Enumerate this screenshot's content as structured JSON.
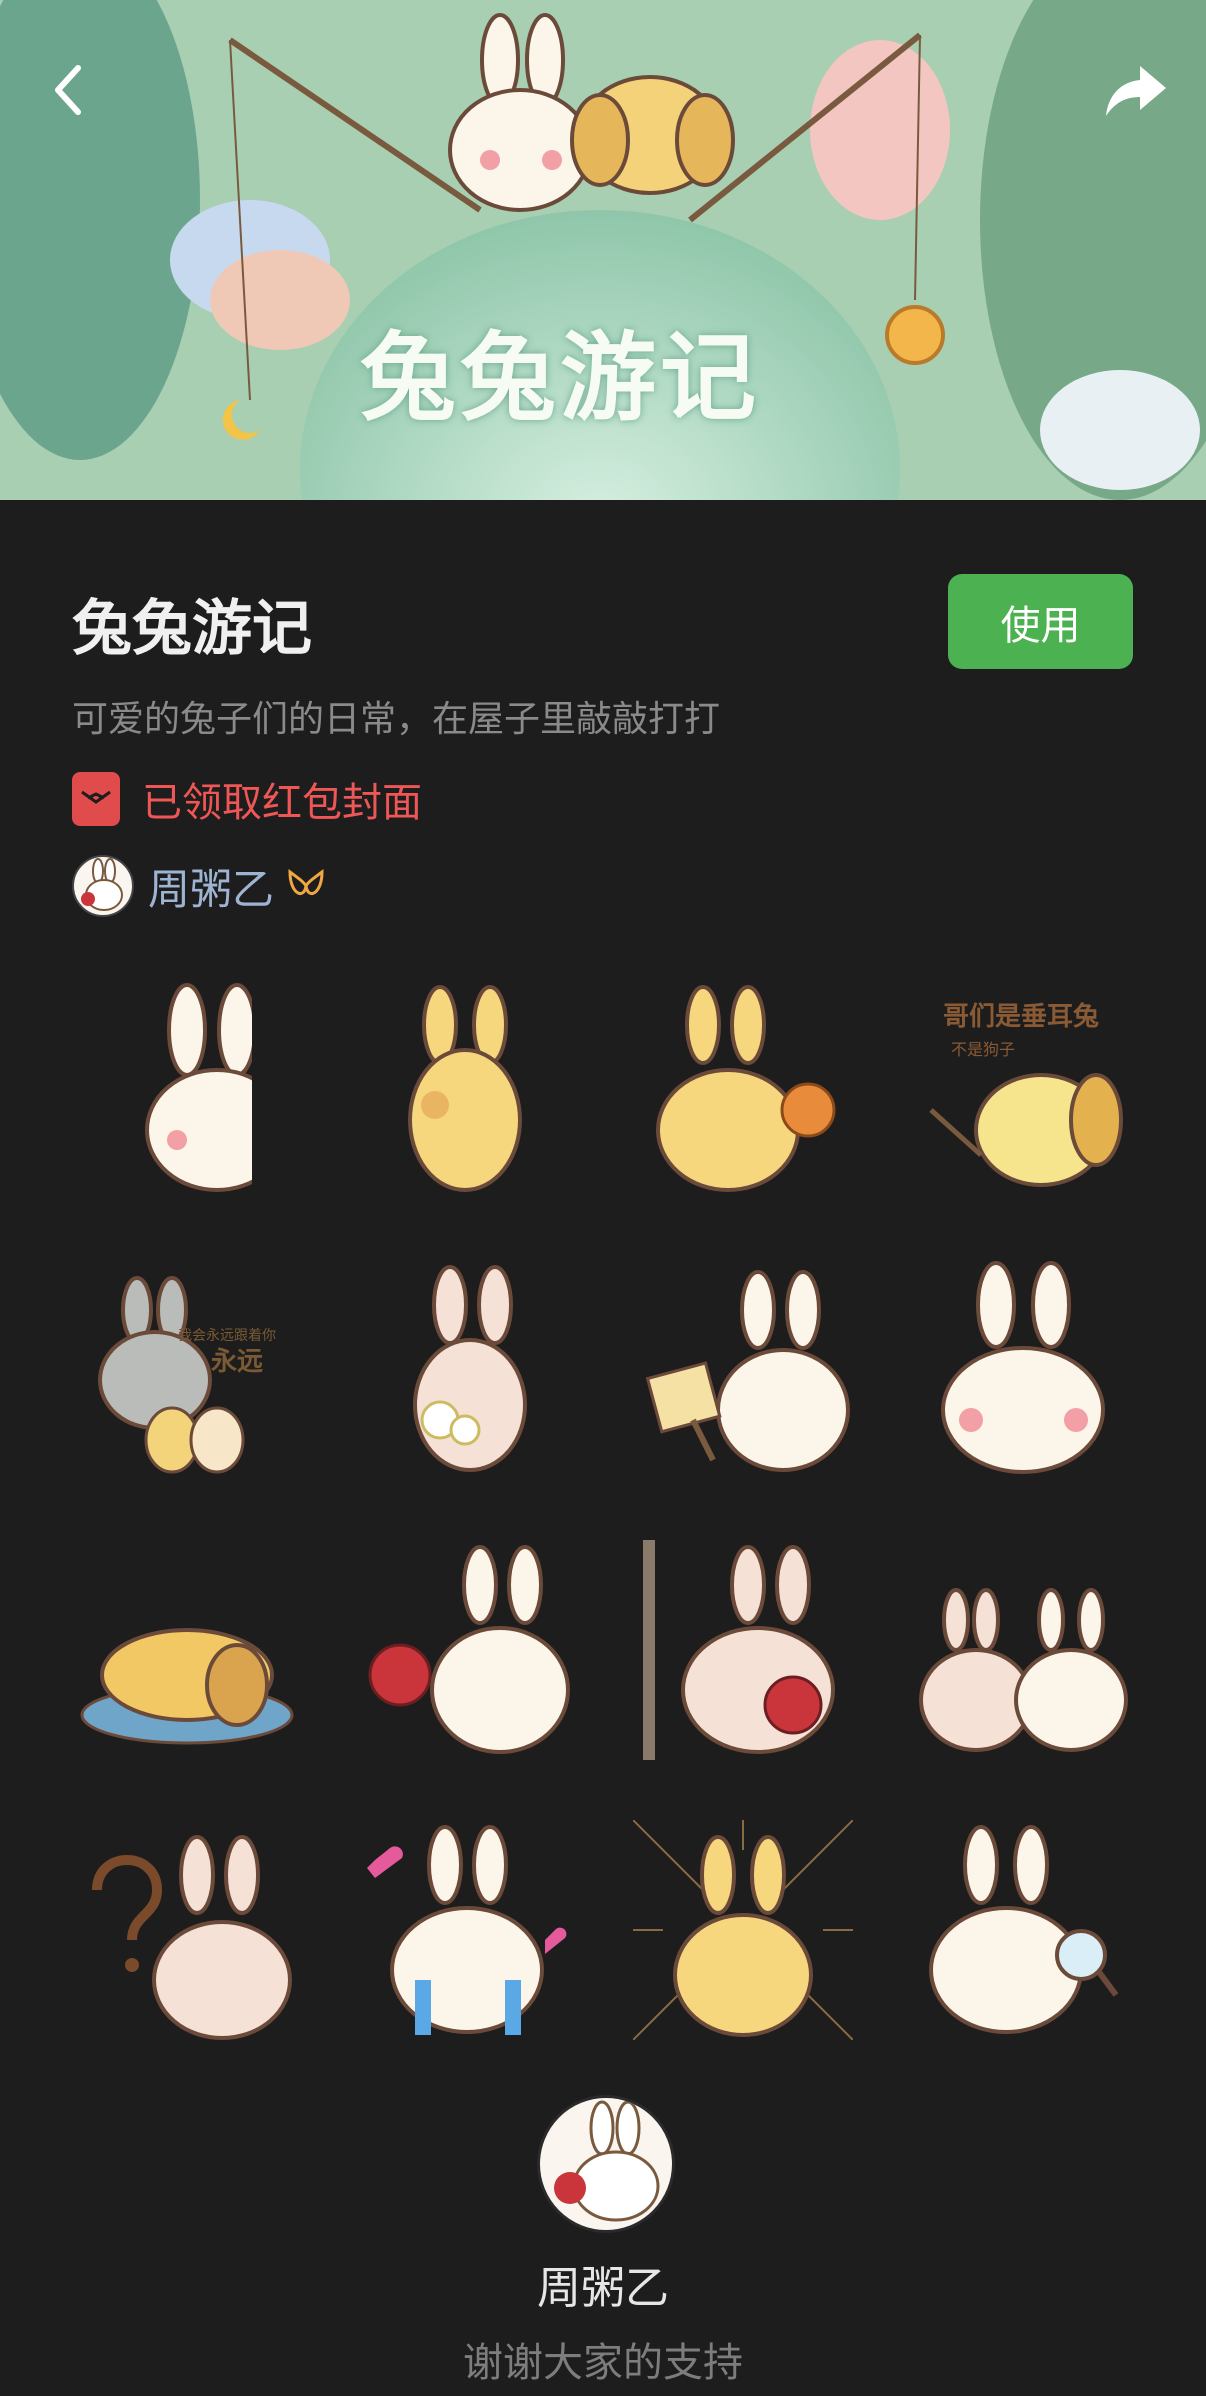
{
  "app": {
    "title": "兔兔游记"
  },
  "banner": {
    "artwork_text": "兔兔游记"
  },
  "pack": {
    "title": "兔兔游记",
    "use_button": "使用",
    "description": "可爱的兔子们的日常，在屋子里敲敲打打",
    "cover_status": "已领取红包封面",
    "author": "周粥乙"
  },
  "stickers": [
    {
      "name": "rabbit-peek",
      "caption": ""
    },
    {
      "name": "yellow-rabbit-shy",
      "caption": ""
    },
    {
      "name": "yellow-rabbit-rose",
      "caption": ""
    },
    {
      "name": "dog-lop-ear",
      "caption": "哥们是垂耳兔",
      "sub": "不是狗子"
    },
    {
      "name": "ghost-rabbit-eggs",
      "caption": "永远",
      "sub": "我会永远跟着你"
    },
    {
      "name": "rabbit-flowers",
      "caption": ""
    },
    {
      "name": "rabbit-sign",
      "caption": ""
    },
    {
      "name": "rabbit-smile",
      "caption": ""
    },
    {
      "name": "dog-melting",
      "caption": ""
    },
    {
      "name": "rabbit-rose-left",
      "caption": ""
    },
    {
      "name": "rabbit-pole-rose",
      "caption": ""
    },
    {
      "name": "two-rabbits",
      "caption": ""
    },
    {
      "name": "rabbit-question",
      "caption": ""
    },
    {
      "name": "rabbit-crying-hearts",
      "caption": ""
    },
    {
      "name": "yellow-rabbit-burst",
      "caption": ""
    },
    {
      "name": "rabbit-magnifier",
      "caption": ""
    }
  ],
  "footer": {
    "name": "周粥乙",
    "thanks": "谢谢大家的支持"
  },
  "colors": {
    "accent": "#4cb150",
    "cover": "#ef5656",
    "author": "#9fb4d3",
    "background": "#1d1d1d"
  }
}
